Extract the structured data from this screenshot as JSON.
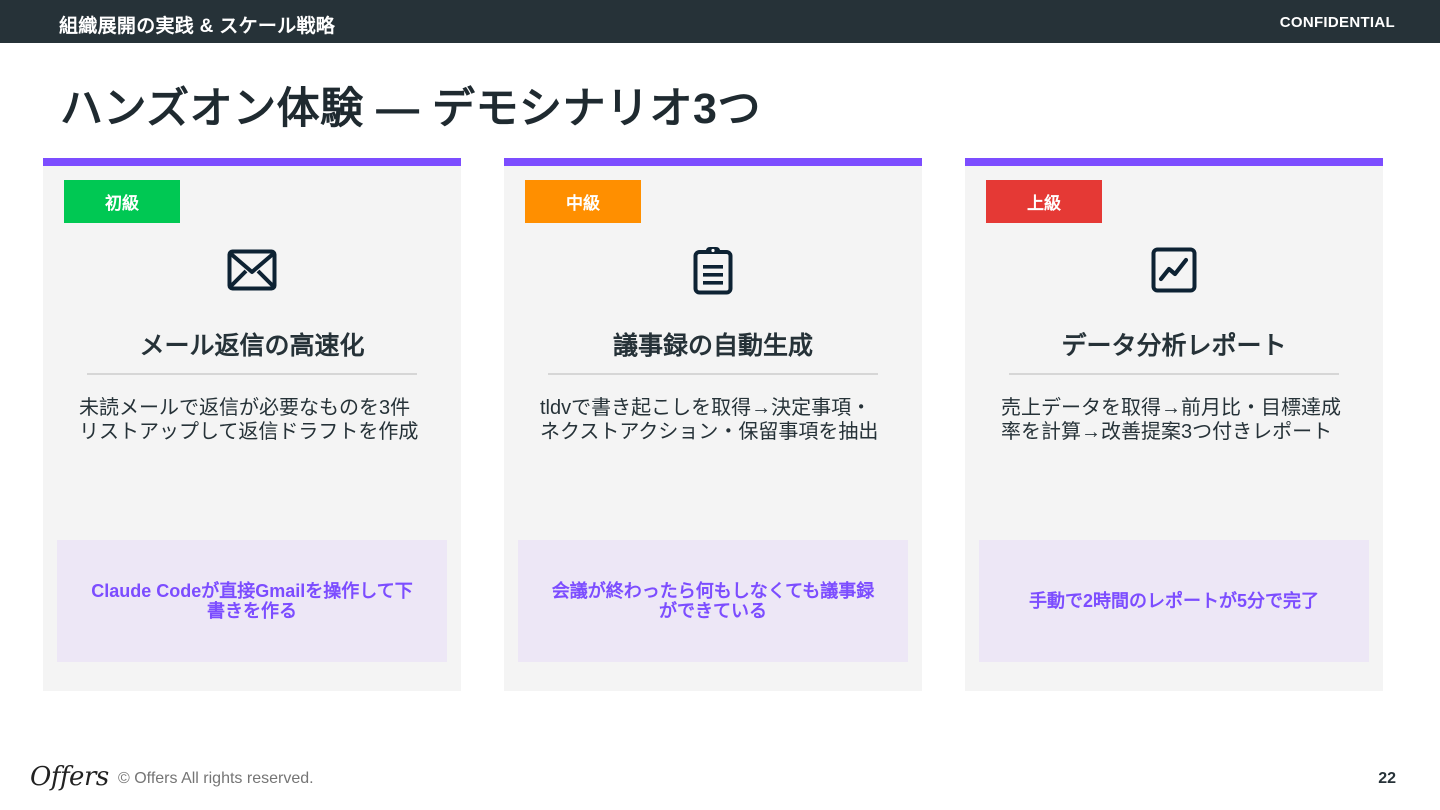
{
  "header": {
    "section_title": "組織展開の実践 & スケール戦略",
    "confidential": "CONFIDENTIAL"
  },
  "page_title": "ハンズオン体験 — デモシナリオ3つ",
  "colors": {
    "header_bg": "#263238",
    "accent": "#7c4dff",
    "card_bg": "#f4f4f4",
    "result_bg": "#ede7f6"
  },
  "cards": [
    {
      "level": "初級",
      "level_color": "#00c853",
      "icon": "envelope-icon",
      "title": "メール返信の高速化",
      "desc_line1": "未読メールで返信が必要なものを3件",
      "desc_line2": "リストアップして返信ドラフトを作成",
      "result": "Claude Codeが直接Gmailを操作して下書きを作る"
    },
    {
      "level": "中級",
      "level_color": "#ff8f00",
      "icon": "clipboard-icon",
      "title": "議事録の自動生成",
      "desc_line1": "tldvで書き起こしを取得→決定事項・",
      "desc_line2": "ネクストアクション・保留事項を抽出",
      "result": "会議が終わったら何もしなくても議事録ができている"
    },
    {
      "level": "上級",
      "level_color": "#e53935",
      "icon": "chart-line-icon",
      "title": "データ分析レポート",
      "desc_line1": "売上データを取得→前月比・目標達成",
      "desc_line2": "率を計算→改善提案3つ付きレポート",
      "result": "手動で2時間のレポートが5分で完了"
    }
  ],
  "footer": {
    "logo": "Offers",
    "copyright": "© Offers All rights reserved.",
    "page_number": "22"
  }
}
